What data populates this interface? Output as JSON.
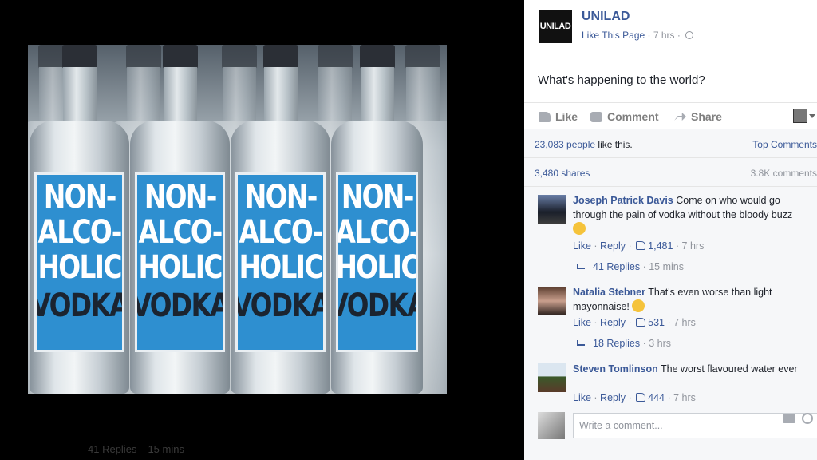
{
  "photo": {
    "bottle_label_lines": [
      "NON-",
      "ALCO-",
      "HOLIC",
      "VODKA"
    ]
  },
  "background": {
    "ghost_replies": "41 Replies",
    "ghost_time": "15 mins"
  },
  "post": {
    "page_logo": "UNILAD",
    "page_name": "UNILAD",
    "like_page": "Like This Page",
    "time": "7 hrs",
    "text": "What's happening to the world?"
  },
  "actions": {
    "like": "Like",
    "comment": "Comment",
    "share": "Share"
  },
  "stats": {
    "likes_count": "23,083 people",
    "likes_suffix": "like this.",
    "top_comments": "Top Comments",
    "shares": "3,480 shares",
    "comments_count": "3.8K comments"
  },
  "comments": [
    {
      "name": "Joseph Patrick Davis",
      "text": "Come on who would go through the pain of vodka without the bloody buzz",
      "like": "Like",
      "reply": "Reply",
      "likes": "1,481",
      "time": "7 hrs",
      "replies": "41 Replies",
      "replies_time": "15 mins"
    },
    {
      "name": "Natalia Stebner",
      "text": "That's even worse than light mayonnaise!",
      "like": "Like",
      "reply": "Reply",
      "likes": "531",
      "time": "7 hrs",
      "replies": "18 Replies",
      "replies_time": "3 hrs"
    },
    {
      "name": "Steven Tomlinson",
      "text": "The worst flavoured water ever",
      "like": "Like",
      "reply": "Reply",
      "likes": "444",
      "time": "7 hrs"
    }
  ],
  "composer": {
    "placeholder": "Write a comment..."
  },
  "colors": {
    "link": "#3b5998",
    "label_blue": "#2e8fd0"
  }
}
